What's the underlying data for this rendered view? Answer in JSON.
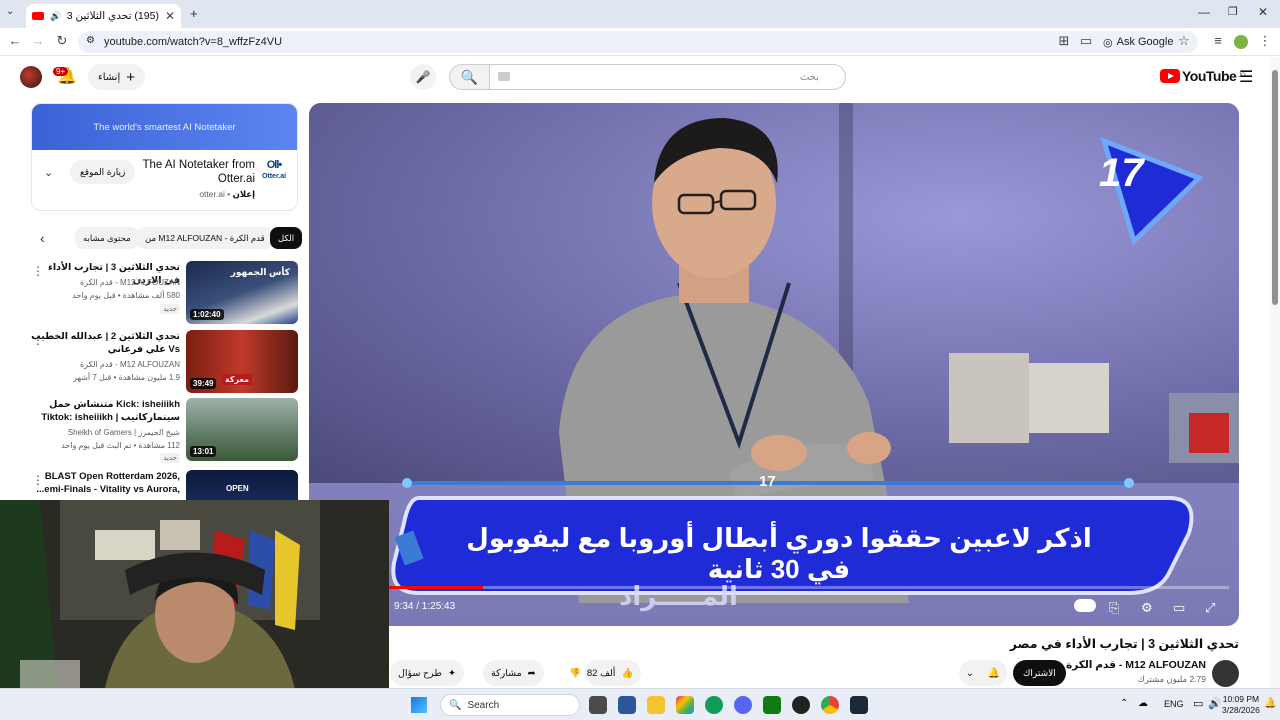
{
  "browser": {
    "tab_title": "(195) تحدي الثلاثين 3 | تجارب",
    "url": "youtube.com/watch?v=8_wffzFz4VU",
    "ask_google": "Ask Google"
  },
  "header": {
    "search_placeholder": "بحث",
    "create_label": "إنشاء",
    "notification_count": "9+",
    "logo_text": "YouTube",
    "logo_region": "JO"
  },
  "ad": {
    "banner_text": "The world's smartest AI Notetaker",
    "title": "The AI Notetaker from Otter.ai",
    "meta_label": "إعلان",
    "meta_domain": "otter.ai",
    "visit_label": "زيارة الموقع",
    "logo_text": "Otter.ai"
  },
  "chips": {
    "all": "الكل",
    "from_channel": "من M12 ALFOUZAN - قدم الكرة",
    "related": "محتوى مشابه"
  },
  "recommendations": [
    {
      "title": "تحدي الثلاثين 3 | تجارب الأداء في الاردن",
      "channel": "M12 ALFOUZAN - قدم الكرة",
      "views": "580 ألف مشاهدة • قبل يوم واحد",
      "badge": "جديد",
      "duration": "1:02:40"
    },
    {
      "title": "تحدي الثلاثين 2 | عبدالله الخطيب Vs علي فرعاني",
      "channel": "M12 ALFOUZAN - قدم الكرة",
      "views": "1.9 مليون مشاهدة • قبل 7 أشهر",
      "badge": "",
      "duration": "39:49"
    },
    {
      "title": "Kick: isheiiikh متنشاش حمل سينماركاتيب | Tiktok: isheiiikh",
      "channel": "شيخ الجيمرز | Sheikh of Gamers",
      "views": "112 مشاهدة • تم البث قبل يوم واحد",
      "badge": "جديد",
      "duration": "13:01"
    },
    {
      "title": "BLAST Open Rotterdam 2026, ...emi-Finals - Vitality vs Aurora,",
      "channel": "",
      "views": "",
      "badge": "",
      "duration": ""
    }
  ],
  "player": {
    "counter": "17",
    "quiz_number": "17",
    "quiz_question": "اذكر لاعبين حققوا دوري أبطال أوروبا مع ليفوبول في 30 ثانية",
    "quiz_sub": "المـــــزاد",
    "time_current": "9:34",
    "time_total": "1:25:43",
    "time_display": "9:34 / 1:25:43",
    "progress": 0.112
  },
  "video": {
    "title": "تحدي الثلاثين 3 | تجارب الأداء في مصر",
    "channel_name": "M12 ALFOUZAN - قدم الكرة",
    "subscribers": "2.79 مليون مشترك",
    "subscribe_label": "الاشتراك",
    "likes": "82 ألف",
    "share_label": "مشاركة",
    "ask_label": "طرح سؤال"
  },
  "taskbar": {
    "search_label": "Search",
    "lang": "ENG",
    "time": "10:09 PM",
    "date": "3/28/2026"
  },
  "colors": {
    "accent": "#ff0000",
    "quiz_blue": "#1f2bd6",
    "chrome_bg": "#dfe5f1"
  }
}
